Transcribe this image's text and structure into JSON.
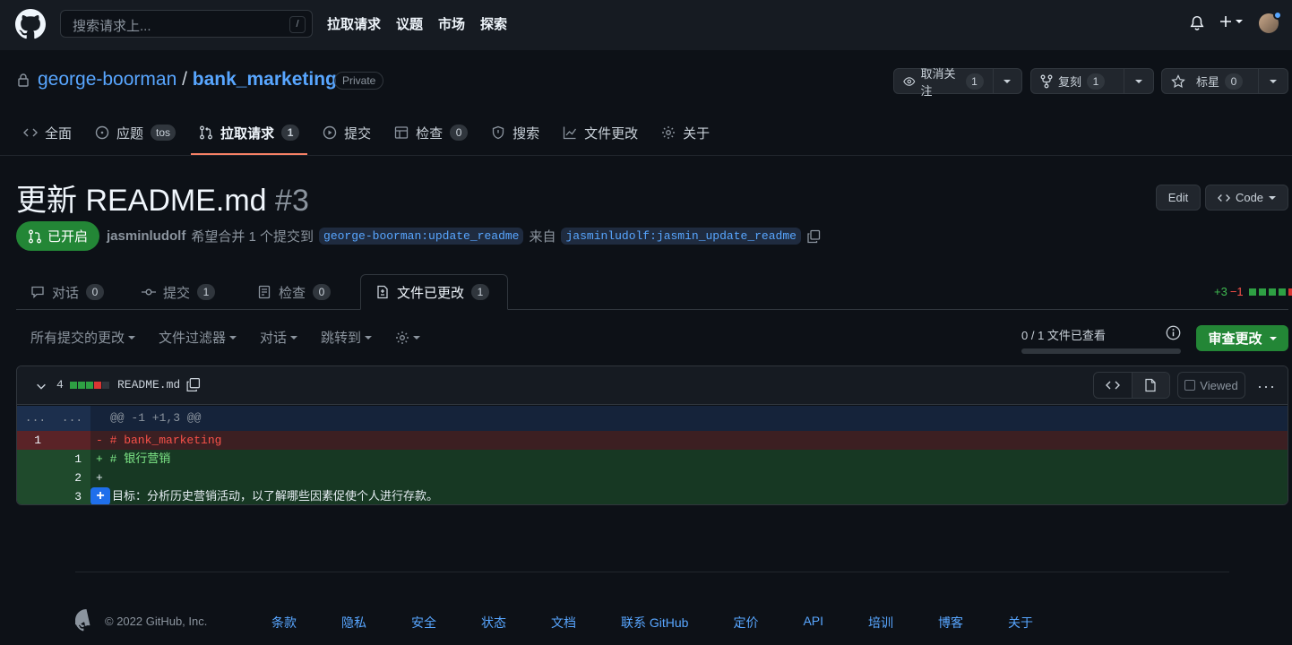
{
  "header": {
    "search_placeholder": "搜索请求上...",
    "search_shortcut": "/",
    "nav": [
      "拉取请求",
      "议题",
      "市场",
      "探索"
    ]
  },
  "repo": {
    "owner": "george-boorman",
    "separator": "/",
    "name": "bank_marketing",
    "visibility": "Private",
    "watch_label": "取消关注",
    "watch_count": "1",
    "fork_label": "复刻",
    "fork_count": "1",
    "star_label": "标星",
    "star_count": "0"
  },
  "repo_tabs": [
    {
      "label": "全面",
      "icon": "code-icon",
      "counter": ""
    },
    {
      "label": "应题",
      "icon": "issue-icon",
      "counter": "tos"
    },
    {
      "label": "拉取请求",
      "icon": "pull-request-icon",
      "counter": "1"
    },
    {
      "label": "提交",
      "icon": "play-icon",
      "counter": ""
    },
    {
      "label": "检查",
      "icon": "table-icon",
      "counter": "0"
    },
    {
      "label": "搜索",
      "icon": "shield-icon",
      "counter": ""
    },
    {
      "label": "文件更改",
      "icon": "graph-icon",
      "counter": ""
    },
    {
      "label": "关于",
      "icon": "gear-icon",
      "counter": ""
    }
  ],
  "pr": {
    "title": "更新 README.md",
    "number": "#3",
    "edit_label": "Edit",
    "code_label": "Code",
    "state": "已开启",
    "author": "jasminludolf",
    "action_text": "希望合并 1 个提交到",
    "base_branch": "george-boorman:update_readme",
    "from_text": "来自",
    "head_branch": "jasminludolf:jasmin_update_readme"
  },
  "pr_tabs": [
    {
      "label": "对话",
      "counter": "0"
    },
    {
      "label": "提交",
      "counter": "1"
    },
    {
      "label": "检查",
      "counter": "0"
    },
    {
      "label": "文件已更改",
      "counter": "1"
    }
  ],
  "diffstat": {
    "additions": "+3",
    "deletions": "−1"
  },
  "toolbar": {
    "all_commits": "所有提交的更改",
    "file_filter": "文件过滤器",
    "conversations": "对话",
    "jump_to": "跳转到",
    "files_viewed": "0 / 1 文件已查看",
    "files_viewed_progress": 0,
    "review_button": "审查更改"
  },
  "file": {
    "change_count": "4",
    "name": "README.md",
    "viewed_label": "Viewed",
    "hunk_ellipsis_left": "...",
    "hunk_ellipsis_right": "...",
    "hunk_header": "@@ -1 +1,3 @@",
    "lines": [
      {
        "old": "1",
        "new": "",
        "text": "- # bank_marketing"
      },
      {
        "old": "",
        "new": "1",
        "text": "+ # 银行营销"
      },
      {
        "old": "",
        "new": "2",
        "text": "+"
      },
      {
        "old": "",
        "new": "3",
        "text": "目标：分析历史营销活动，以了解哪些因素促使个人进行存款。"
      }
    ]
  },
  "footer": {
    "copyright": "© 2022 GitHub, Inc.",
    "links": [
      "条款",
      "隐私",
      "安全",
      "状态",
      "文档",
      "联系 GitHub",
      "定价",
      "API",
      "培训",
      "博客",
      "关于"
    ]
  },
  "colors": {
    "accent_green": "#238636",
    "link_blue": "#58a6ff",
    "tab_underline": "#f78166",
    "background": "#0d1117"
  }
}
